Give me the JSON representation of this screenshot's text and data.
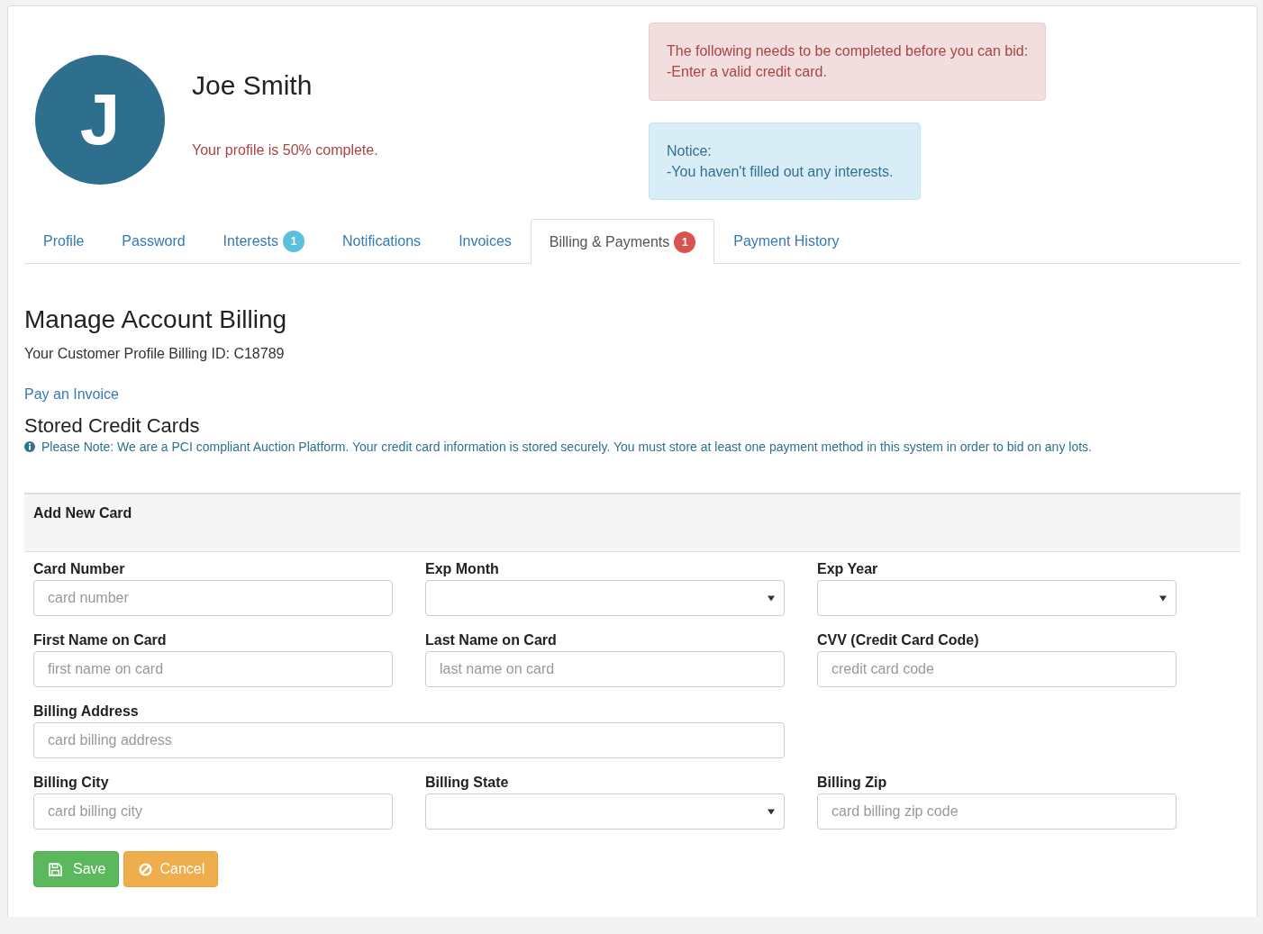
{
  "profile": {
    "initial": "J",
    "name": "Joe Smith",
    "completion": "Your profile is 50% complete."
  },
  "alerts": [
    {
      "kind": "danger",
      "lines": [
        "The following needs to be completed before you can bid:",
        "-Enter a valid credit card."
      ]
    },
    {
      "kind": "info",
      "lines": [
        "Notice:",
        "-You haven't filled out any interests."
      ]
    }
  ],
  "tabs": [
    {
      "label": "Profile",
      "selected": false
    },
    {
      "label": "Password",
      "selected": false
    },
    {
      "label": "Interests",
      "selected": false,
      "badge": {
        "text": "1",
        "color": "#5bc0de"
      }
    },
    {
      "label": "Notifications",
      "selected": false
    },
    {
      "label": "Invoices",
      "selected": false
    },
    {
      "label": "Billing & Payments",
      "selected": true,
      "badge": {
        "text": "1",
        "color": "#d9534f"
      }
    },
    {
      "label": "Payment History",
      "selected": false
    }
  ],
  "heading": "Manage Account Billing",
  "billing_id": "Your Customer Profile Billing ID: C18789",
  "pay_link": "Pay an Invoice",
  "stored_cards": {
    "title": "Stored Credit Cards",
    "note": "Please Note: We are a PCI compliant Auction Platform. Your credit card information is stored securely. You must store at least one payment method in this system in order to bid on any lots."
  },
  "form": {
    "title": "Add New Card",
    "fields": [
      {
        "label": "Card Number",
        "kind": "input",
        "placeholder": "card number"
      },
      {
        "label": "Exp Month",
        "kind": "select"
      },
      {
        "label": "Exp Year",
        "kind": "select"
      },
      {
        "label": "First Name on Card",
        "kind": "input",
        "placeholder": "first name on card"
      },
      {
        "label": "Last Name on Card",
        "kind": "input",
        "placeholder": "last name on card"
      },
      {
        "label": "CVV (Credit Card Code)",
        "kind": "input",
        "placeholder": "credit card code"
      },
      {
        "label": "Billing Address",
        "kind": "wide-input",
        "placeholder": "card billing address"
      },
      {
        "label": "Billing City",
        "kind": "input",
        "placeholder": "card billing city"
      },
      {
        "label": "Billing State",
        "kind": "select"
      },
      {
        "label": "Billing Zip",
        "kind": "input",
        "placeholder": "card billing zip code"
      }
    ],
    "buttons": [
      {
        "kind": "save",
        "label": "Save"
      },
      {
        "kind": "cancel",
        "label": "Cancel"
      }
    ]
  }
}
